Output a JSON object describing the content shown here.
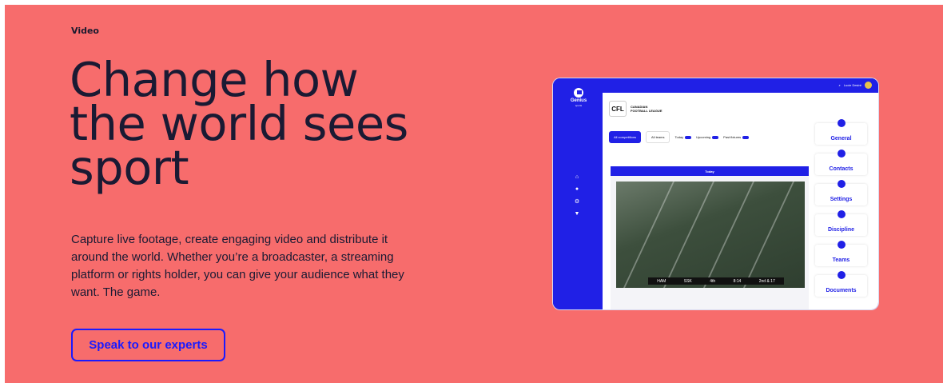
{
  "section_label": "Video",
  "headline": "Change how the world sees sport",
  "description": "Capture live footage, create engaging video and distribute it around the world. Whether you’re a broadcaster, a streaming platform or rights holder, you can give your audience what they want. The game.",
  "cta_label": "Speak to our experts",
  "colors": {
    "background": "#f76c6c",
    "accent": "#1a1aff",
    "text": "#1a1a33"
  },
  "mockup": {
    "logo_text": "Genius",
    "logo_sub": "sports",
    "user_name": "Lucie Desiré",
    "league_badge": "CFL",
    "league_name_top": "CANADIAN",
    "league_name": "FOOTBALL LEAGUE",
    "filters": {
      "competitions": "All competitions",
      "teams": "All teams",
      "toggles": [
        "Today",
        "Upcoming",
        "Past fixtures"
      ]
    },
    "today_label": "Today",
    "scoreboard": [
      "HAM",
      "SSK",
      "4th",
      "8:14",
      "2nd & 17"
    ],
    "cards": [
      "General",
      "Contacts",
      "Settings",
      "Discipline",
      "Teams",
      "Documents"
    ],
    "side_icons": [
      "home-icon",
      "users-icon",
      "settings-icon",
      "filter-icon"
    ]
  }
}
